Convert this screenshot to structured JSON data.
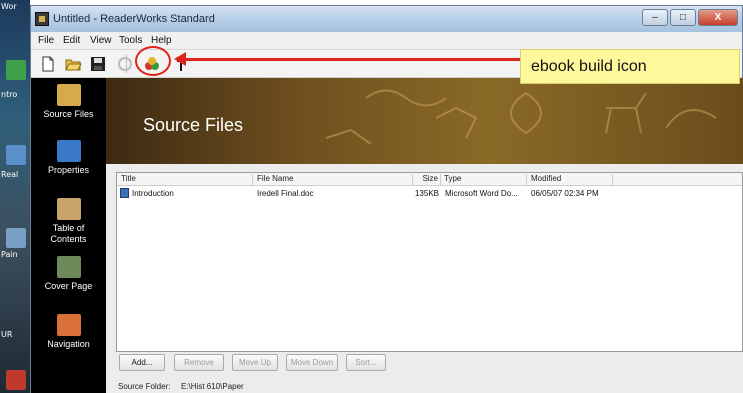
{
  "desktop": {
    "labels": [
      "Wor",
      "ntro",
      "Real",
      "Pain",
      "UR"
    ]
  },
  "window": {
    "title": "Untitled - ReaderWorks Standard",
    "controls": {
      "minimize": "–",
      "maximize": "□",
      "close": "X"
    }
  },
  "menu": [
    "File",
    "Edit",
    "View",
    "Tools",
    "Help"
  ],
  "nav": [
    {
      "label": "Source Files",
      "icon": "source-files-icon"
    },
    {
      "label": "Properties",
      "icon": "properties-icon"
    },
    {
      "label": "Table of Contents",
      "icon": "table-of-contents-icon"
    },
    {
      "label": "Cover Page",
      "icon": "cover-page-icon"
    },
    {
      "label": "Navigation",
      "icon": "navigation-icon"
    }
  ],
  "banner": {
    "title": "Source Files"
  },
  "list": {
    "columns": [
      "Title",
      "File Name",
      "Size",
      "Type",
      "Modified"
    ],
    "rows": [
      {
        "title": "Introduction",
        "file_name": "Iredell Final.doc",
        "size": "135KB",
        "type": "Microsoft Word Do...",
        "modified": "06/05/07 02:34 PM"
      }
    ]
  },
  "buttons": {
    "add": "Add...",
    "remove": "Remove",
    "move_up": "Move Up",
    "move_down": "Move Down",
    "sort": "Sort..."
  },
  "source_folder": {
    "label": "Source Folder:",
    "value": "E:\\Hist 610\\Paper"
  },
  "annotation": {
    "text": "ebook build icon"
  },
  "colors": {
    "annotation_red": "#e0221a",
    "annotation_box": "#fff79c",
    "nav_bg": "#000000"
  }
}
